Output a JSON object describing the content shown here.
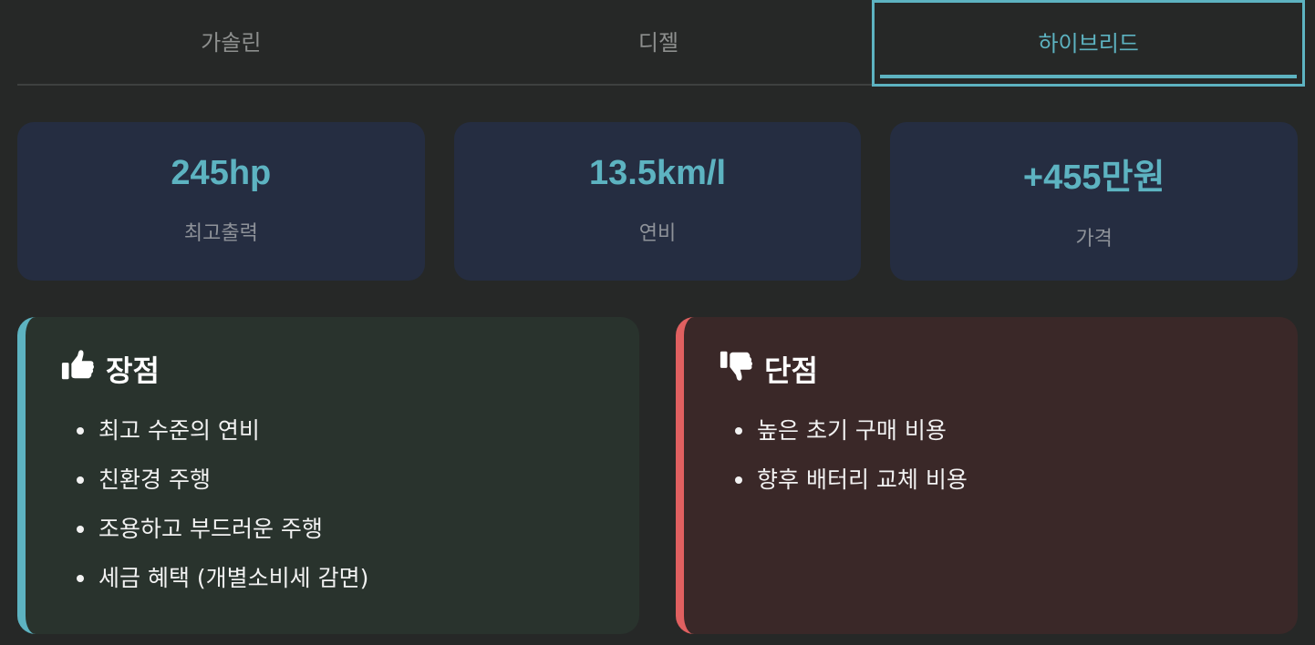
{
  "tabs": [
    {
      "label": "가솔린",
      "active": false
    },
    {
      "label": "디젤",
      "active": false
    },
    {
      "label": "하이브리드",
      "active": true
    }
  ],
  "stats": [
    {
      "value": "245hp",
      "label": "최고출력"
    },
    {
      "value": "13.5km/l",
      "label": "연비"
    },
    {
      "value": "+455만원",
      "label": "가격"
    }
  ],
  "pros": {
    "icon": "thumbs-up-icon",
    "title": "장점",
    "items": [
      "최고 수준의 연비",
      "친환경 주행",
      "조용하고 부드러운 주행",
      "세금 혜택 (개별소비세 감면)"
    ]
  },
  "cons": {
    "icon": "thumbs-down-icon",
    "title": "단점",
    "items": [
      "높은 초기 구매 비용",
      "향후 배터리 교체 비용"
    ]
  },
  "colors": {
    "accent": "#5db3c1",
    "negative": "#e06060",
    "background": "#262827"
  }
}
